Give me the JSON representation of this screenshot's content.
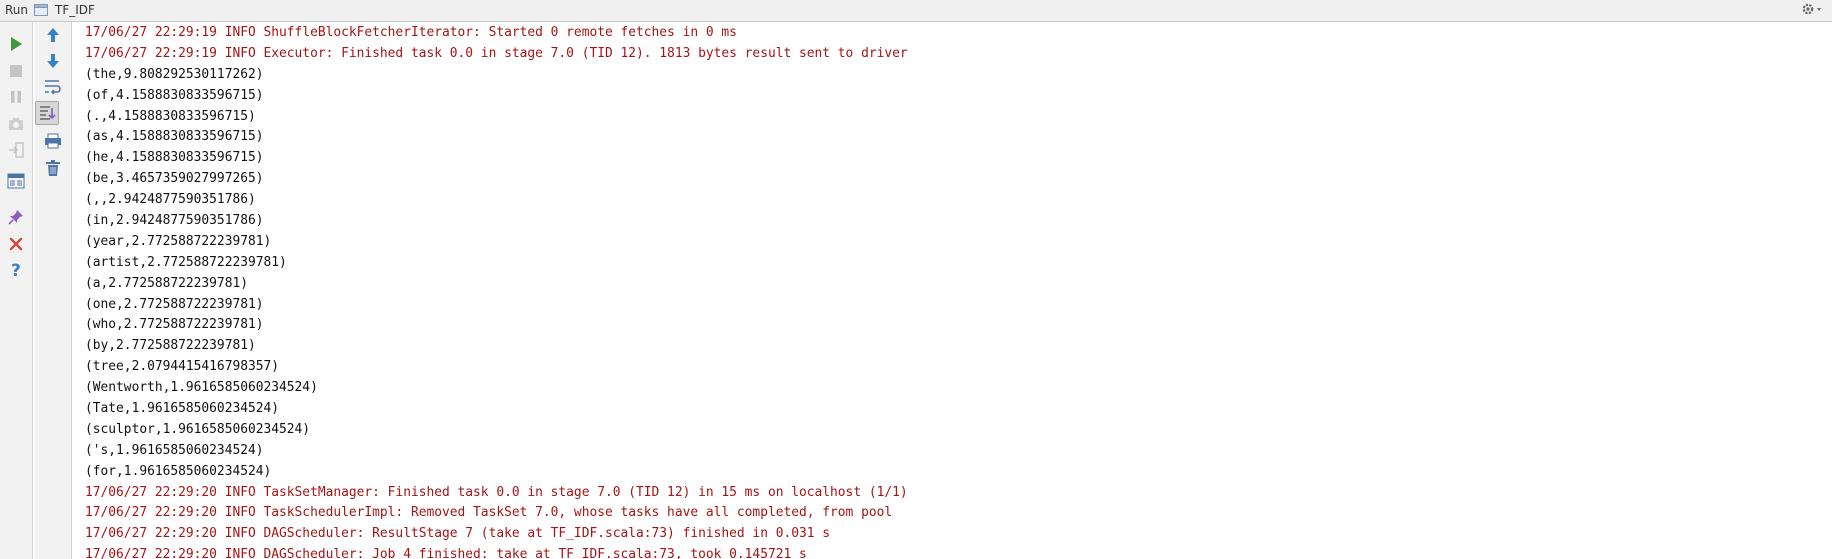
{
  "window": {
    "run_label": "Run",
    "tab_label": "TF_IDF"
  },
  "colors": {
    "stderr": "#a31515",
    "stdout": "#111111",
    "run_green": "#3c9a3c",
    "arrow_blue": "#3b7fc4",
    "close_red": "#d9443a"
  },
  "left_toolbar": {
    "buttons": [
      {
        "name": "rerun-button",
        "icon": "play-icon"
      },
      {
        "name": "stop-button",
        "icon": "stop-icon"
      },
      {
        "name": "pause-button",
        "icon": "pause-icon"
      },
      {
        "name": "dump-threads-button",
        "icon": "camera-icon"
      },
      {
        "name": "exit-button",
        "icon": "exit-icon"
      },
      {
        "name": "layout-button",
        "icon": "layout-icon"
      },
      {
        "name": "pin-tab-button",
        "icon": "pin-icon"
      },
      {
        "name": "close-button",
        "icon": "close-icon"
      },
      {
        "name": "help-button",
        "icon": "help-icon"
      }
    ]
  },
  "right_toolbar": {
    "buttons": [
      {
        "name": "scroll-up-button",
        "icon": "arrow-up-icon"
      },
      {
        "name": "scroll-down-button",
        "icon": "arrow-down-icon"
      },
      {
        "name": "soft-wrap-button",
        "icon": "wrap-icon"
      },
      {
        "name": "scroll-to-end-button",
        "icon": "scroll-end-icon"
      },
      {
        "name": "print-button",
        "icon": "print-icon"
      },
      {
        "name": "clear-all-button",
        "icon": "trash-icon"
      }
    ]
  },
  "console": {
    "lines": [
      {
        "stream": "err",
        "text": "17/06/27 22:29:19 INFO ShuffleBlockFetcherIterator: Started 0 remote fetches in 0 ms"
      },
      {
        "stream": "err",
        "text": "17/06/27 22:29:19 INFO Executor: Finished task 0.0 in stage 7.0 (TID 12). 1813 bytes result sent to driver"
      },
      {
        "stream": "out",
        "text": "(the,9.808292530117262)"
      },
      {
        "stream": "out",
        "text": "(of,4.1588830833596715)"
      },
      {
        "stream": "out",
        "text": "(.,4.1588830833596715)"
      },
      {
        "stream": "out",
        "text": "(as,4.1588830833596715)"
      },
      {
        "stream": "out",
        "text": "(he,4.1588830833596715)"
      },
      {
        "stream": "out",
        "text": "(be,3.4657359027997265)"
      },
      {
        "stream": "out",
        "text": "(,,2.9424877590351786)"
      },
      {
        "stream": "out",
        "text": "(in,2.9424877590351786)"
      },
      {
        "stream": "out",
        "text": "(year,2.772588722239781)"
      },
      {
        "stream": "out",
        "text": "(artist,2.772588722239781)"
      },
      {
        "stream": "out",
        "text": "(a,2.772588722239781)"
      },
      {
        "stream": "out",
        "text": "(one,2.772588722239781)"
      },
      {
        "stream": "out",
        "text": "(who,2.772588722239781)"
      },
      {
        "stream": "out",
        "text": "(by,2.772588722239781)"
      },
      {
        "stream": "out",
        "text": "(tree,2.0794415416798357)"
      },
      {
        "stream": "out",
        "text": "(Wentworth,1.9616585060234524)"
      },
      {
        "stream": "out",
        "text": "(Tate,1.9616585060234524)"
      },
      {
        "stream": "out",
        "text": "(sculptor,1.9616585060234524)"
      },
      {
        "stream": "out",
        "text": "('s,1.9616585060234524)"
      },
      {
        "stream": "out",
        "text": "(for,1.9616585060234524)"
      },
      {
        "stream": "err",
        "text": "17/06/27 22:29:20 INFO TaskSetManager: Finished task 0.0 in stage 7.0 (TID 12) in 15 ms on localhost (1/1)"
      },
      {
        "stream": "err",
        "text": "17/06/27 22:29:20 INFO TaskSchedulerImpl: Removed TaskSet 7.0, whose tasks have all completed, from pool"
      },
      {
        "stream": "err",
        "text": "17/06/27 22:29:20 INFO DAGScheduler: ResultStage 7 (take at TF_IDF.scala:73) finished in 0.031 s"
      },
      {
        "stream": "err",
        "text": "17/06/27 22:29:20 INFO DAGScheduler: Job 4 finished: take at TF_IDF.scala:73, took 0.145721 s"
      }
    ]
  }
}
